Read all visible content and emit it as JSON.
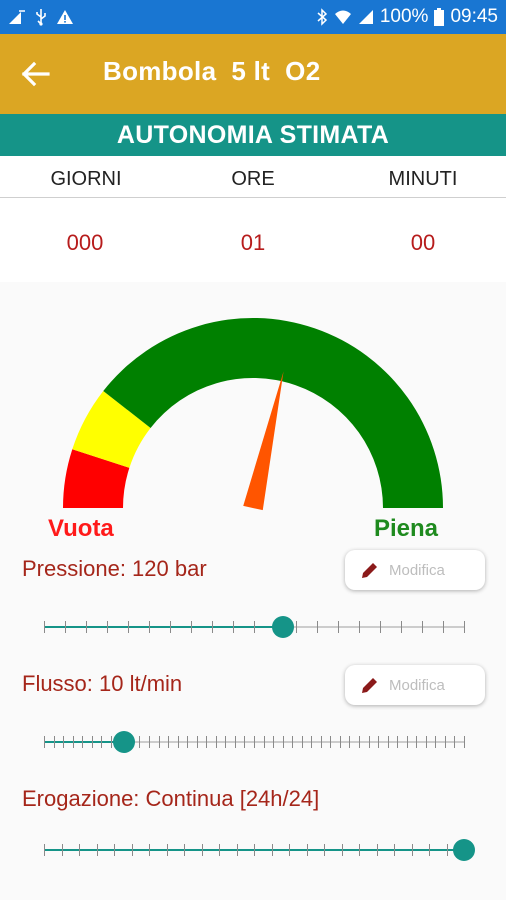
{
  "status_bar": {
    "battery_percent": "100%",
    "time": "09:45",
    "icons": [
      "signal-icon",
      "usb-icon",
      "warning-icon",
      "bluetooth-icon",
      "wifi-icon",
      "cell-signal-icon",
      "battery-icon"
    ]
  },
  "app_bar": {
    "title": "Bombola  5 lt  O2",
    "back_icon": "back-arrow-icon"
  },
  "autonomy": {
    "header": "AUTONOMIA STIMATA",
    "columns": [
      {
        "label": "GIORNI",
        "value": "000"
      },
      {
        "label": "ORE",
        "value": "01"
      },
      {
        "label": "MINUTI",
        "value": "00"
      }
    ]
  },
  "gauge": {
    "label_empty": "Vuota",
    "label_full": "Piena",
    "needle_level": 0.57,
    "colors": {
      "red": "#ff0000",
      "yellow": "#ffff00",
      "green": "#008000",
      "needle": "#ff5500"
    }
  },
  "pressure": {
    "label": "Pressione: 120 bar",
    "edit_label": "Modifica",
    "slider_level": 0.57,
    "ticks": 20
  },
  "flow": {
    "label": "Flusso: 10 lt/min",
    "edit_label": "Modifica",
    "slider_level": 0.19,
    "ticks": 44
  },
  "delivery": {
    "label": "Erogazione: Continua [24h/24]",
    "slider_level": 1.0,
    "ticks": 24
  },
  "colors": {
    "status_bar": "#1976d2",
    "app_bar": "#dba623",
    "accent": "#159488",
    "value_text": "#b71c1c",
    "row_label": "#a5261a"
  }
}
